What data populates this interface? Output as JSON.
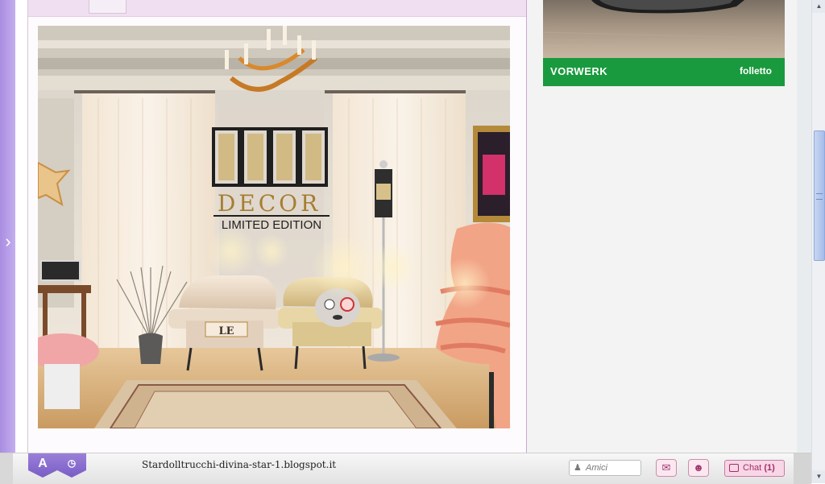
{
  "colors": {
    "sidebar_purple": "#a98de0",
    "panel_border": "#c9a7cf",
    "ad_green": "#1a9a3e",
    "chat_pink": "#f8d6e6"
  },
  "hero": {
    "logo_letters": "LE",
    "logo_word": "DECOR",
    "logo_subtitle": "LIMITED EDITION",
    "cushion_letters": "LE"
  },
  "ad": {
    "brand": "VORWERK",
    "product": "folletto"
  },
  "bottom_bar": {
    "url": "Stardolltrucchi-divina-star-1.blogspot.it",
    "friends_placeholder": "Amici",
    "chat_label": "Chat",
    "chat_count": "(1)",
    "icons": [
      "shield-a-icon",
      "shield-clock-icon",
      "friends-icon",
      "mail-icon",
      "message-icon",
      "chat-icon"
    ]
  }
}
